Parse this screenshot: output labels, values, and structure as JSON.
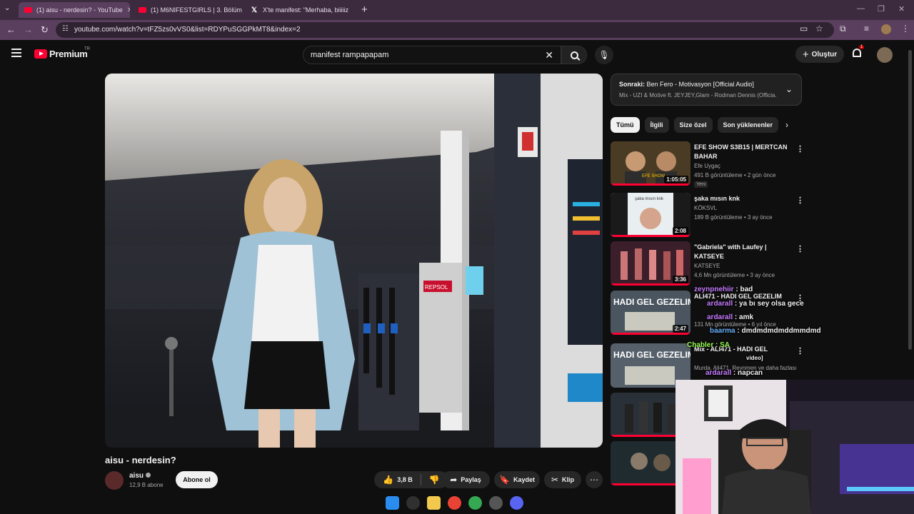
{
  "browser": {
    "tabs": [
      {
        "label": "(1) aisu - nerdesin? - YouTube",
        "active": true
      },
      {
        "label": "(1) M6NIFESTGIRLS | 3. Bölüm",
        "active": false
      },
      {
        "label": "X'te manifest: \"Merhaba, biiiiiz",
        "active": false
      }
    ],
    "url": "youtube.com/watch?v=tFZ5zs0vVS0&list=RDYPuSGGPkMT8&index=2"
  },
  "header": {
    "logo_text": "Premium",
    "country": "TR",
    "search_value": "manifest rampapapam",
    "create_label": "Oluştur",
    "notification_count": "1"
  },
  "video": {
    "title": "aisu - nerdesin?",
    "channel": "aisu",
    "subscribers": "12,9 B abone",
    "subscribe_label": "Abone ol",
    "likes": "3,8 B",
    "share_label": "Paylaş",
    "save_label": "Kaydet",
    "clip_label": "Klip"
  },
  "upnext": {
    "prefix": "Sonraki:",
    "title": "Ben Fero - Motivasyon [Official Audio]",
    "subtitle": "Mix - UZI & Motive ft. JEYJEY,Glam - Rodman Dennis (Officia..."
  },
  "chips": [
    "Tümü",
    "İlgili",
    "Size özel",
    "Son yüklenenler"
  ],
  "recommendations": [
    {
      "title": "EFE SHOW S3B15 | MERTCAN BAHAR",
      "channel": "Efe Uygaç",
      "stats": "491 B görüntüleme • 2 gün önce",
      "duration": "1:05:05",
      "badge": "Yeni",
      "progress": 1.0
    },
    {
      "title": "şaka mısın knk",
      "channel": "KÖKSVL",
      "stats": "189 B görüntüleme • 3 ay önce",
      "duration": "2:08",
      "progress": 1.0
    },
    {
      "title": "\"Gabriela\" with Laufey | KATSEYE",
      "channel": "KATSEYE",
      "stats": "4,6 Mn görüntüleme • 3 ay önce",
      "duration": "3:36",
      "progress": 1.0
    },
    {
      "title": "ALI471 - HADI GEL GEZELIM",
      "channel": "",
      "stats": "131 Mn görüntüleme • 6 yıl önce",
      "duration": "2:47",
      "progress": 1.0
    },
    {
      "title": "Mix - ALI471 - HADI GEL",
      "channel": "",
      "stats": "Murda, Ali471, Reynmen ve daha fazlası",
      "duration": "",
      "progress": 0.0
    },
    {
      "title": "",
      "channel": "",
      "stats": "",
      "duration": "",
      "progress": 1.0
    },
    {
      "title": "",
      "channel": "",
      "stats": "",
      "duration": "",
      "progress": 1.0
    }
  ],
  "thumb_texts": {
    "rec2": "şaka mısın knk",
    "rec4": "HADI GEL GEZELIM",
    "rec5": "HADI GEL GEZELIM",
    "rec1": "EFE SHOW"
  },
  "player_sign": "REPSOL",
  "chat": [
    {
      "user": "zeynpnehiir",
      "msg": ": bad"
    },
    {
      "user": "ardarall",
      "msg": ": ya bı sey olsa gece"
    },
    {
      "user": "ardarall",
      "msg": ": amk"
    },
    {
      "user": "baarma",
      "msg": ": dmdmdmdmddmmdmd"
    },
    {
      "user": "Chabler",
      "msg": ": SA"
    },
    {
      "user": "",
      "msg": "video]"
    },
    {
      "user": "ardarall",
      "msg": ": napcan"
    }
  ]
}
